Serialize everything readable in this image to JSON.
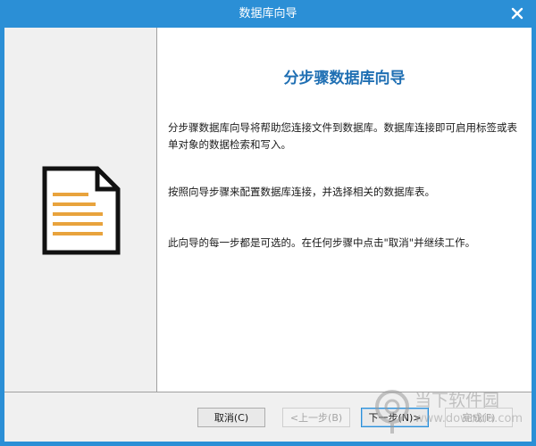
{
  "window": {
    "title": "数据库向导",
    "close_icon": "close-icon"
  },
  "content": {
    "heading": "分步骤数据库向导",
    "paragraph1": "分步骤数据库向导将帮助您连接文件到数据库。数据库连接即可启用标签或表单对象的数据检索和写入。",
    "paragraph2": "按照向导步骤来配置数据库连接，并选择相关的数据库表。",
    "paragraph3": "此向导的每一步都是可选的。在任何步骤中点击\"取消\"并继续工作。"
  },
  "left_panel": {
    "icon": "document-icon",
    "icon_color": "#e8a33d"
  },
  "footer": {
    "cancel_label": "取消(C)",
    "prev_label": "<上一步(B)",
    "next_label": "下一步(N)>",
    "finish_label": "完成(F)"
  },
  "watermark": {
    "text": "当下软件园",
    "url": "www.downxia.com"
  },
  "colors": {
    "title_bar": "#2b8fd6",
    "heading": "#1f6fb3"
  }
}
